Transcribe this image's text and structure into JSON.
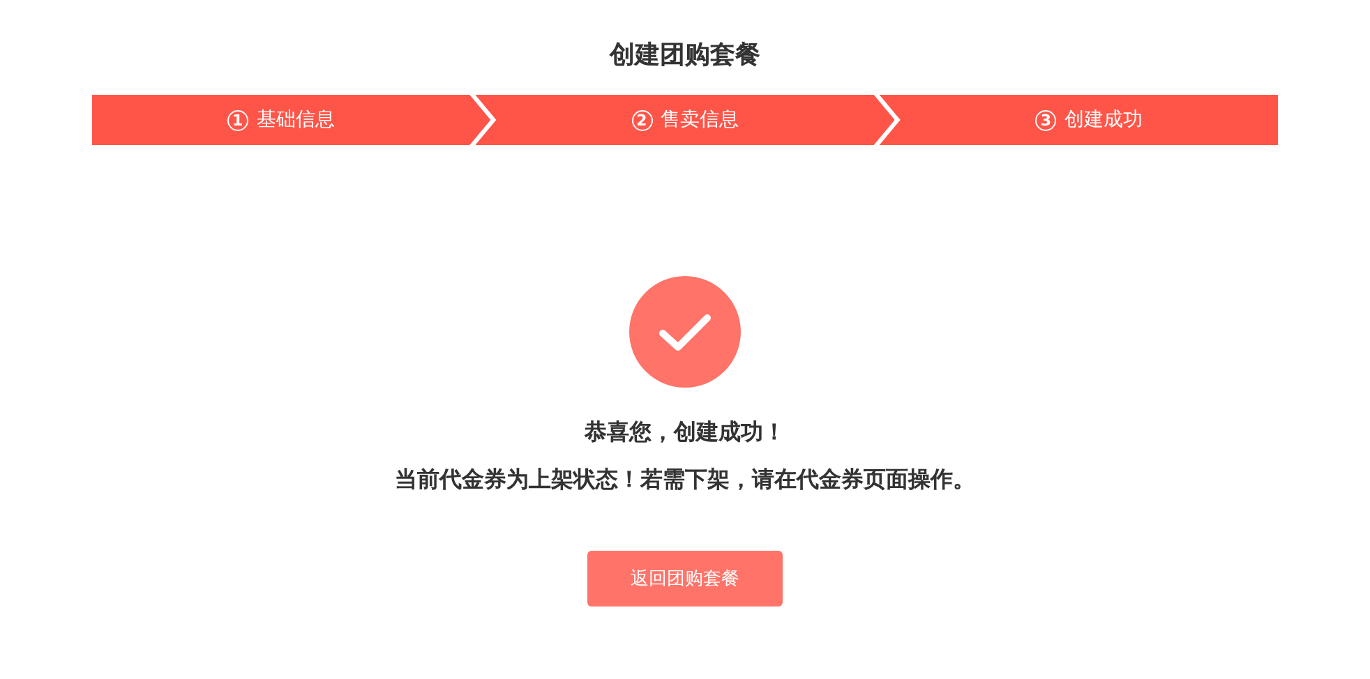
{
  "title": "创建团购套餐",
  "steps": [
    {
      "number": "1",
      "label": "基础信息"
    },
    {
      "number": "2",
      "label": "售卖信息"
    },
    {
      "number": "3",
      "label": "创建成功"
    }
  ],
  "result": {
    "heading": "恭喜您，创建成功！",
    "message": "当前代金券为上架状态！若需下架，请在代金券页面操作。"
  },
  "button": "返回团购套餐"
}
